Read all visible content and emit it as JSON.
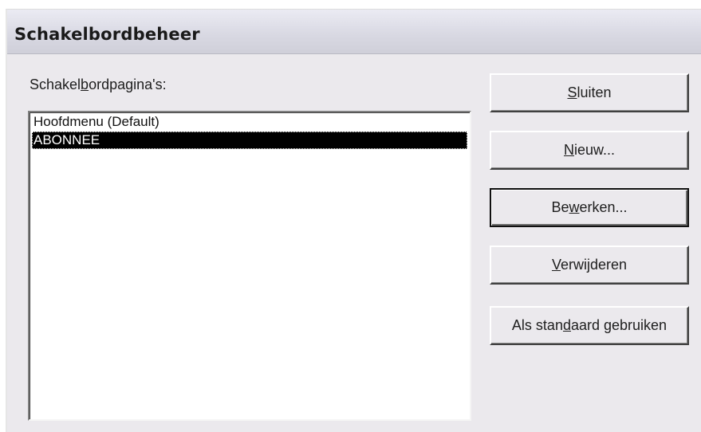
{
  "window": {
    "title": "Schakelbordbeheer"
  },
  "list": {
    "label_before": "Schakel",
    "label_mnemonic": "b",
    "label_after": "ordpagina's:",
    "items": [
      {
        "label": "Hoofdmenu (Default)",
        "selected": false
      },
      {
        "label": "ABONNEE",
        "selected": true
      }
    ]
  },
  "buttons": {
    "close": {
      "before": "",
      "mnemonic": "S",
      "after": "luiten"
    },
    "new": {
      "before": "",
      "mnemonic": "N",
      "after": "ieuw..."
    },
    "edit": {
      "before": "Be",
      "mnemonic": "w",
      "after": "erken..."
    },
    "delete": {
      "before": "",
      "mnemonic": "V",
      "after": "erwijderen"
    },
    "set_default": {
      "before": "Als stan",
      "mnemonic": "d",
      "after": "aard gebruiken"
    }
  }
}
